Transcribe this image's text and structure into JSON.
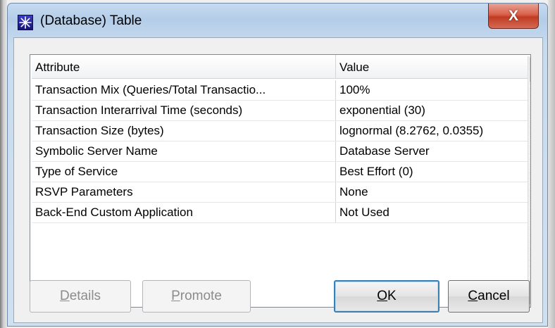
{
  "window": {
    "title": "(Database) Table",
    "icon": "star-burst-icon",
    "close_label": "X"
  },
  "table": {
    "columns": [
      "Attribute",
      "Value"
    ],
    "rows": [
      {
        "attribute": "Transaction Mix (Queries/Total Transactio...",
        "value": "100%"
      },
      {
        "attribute": "Transaction Interarrival Time (seconds)",
        "value": "exponential (30)"
      },
      {
        "attribute": "Transaction Size (bytes)",
        "value": "lognormal (8.2762, 0.0355)"
      },
      {
        "attribute": "Symbolic Server Name",
        "value": "Database Server"
      },
      {
        "attribute": "Type of Service",
        "value": "Best Effort (0)"
      },
      {
        "attribute": "RSVP Parameters",
        "value": "None"
      },
      {
        "attribute": "Back-End Custom Application",
        "value": "Not Used"
      }
    ]
  },
  "buttons": {
    "details": {
      "access": "D",
      "rest": "etails"
    },
    "promote": {
      "access": "P",
      "rest": "romote"
    },
    "ok": {
      "access": "O",
      "rest": "K"
    },
    "cancel": {
      "access": "C",
      "rest": "ancel"
    }
  },
  "colors": {
    "title_bar": "#b4cde8",
    "close_button": "#c13b22",
    "default_button_border": "#3c7fb1"
  }
}
